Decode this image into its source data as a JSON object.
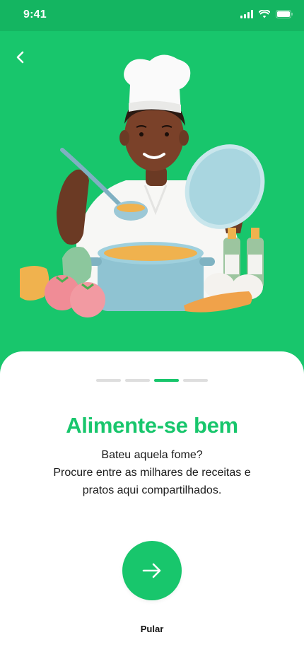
{
  "status_bar": {
    "time": "9:41"
  },
  "onboarding": {
    "step_count": 4,
    "active_step": 3,
    "title": "Alimente-se bem",
    "description_lines": [
      "Bateu aquela fome?",
      "Procure entre as milhares de receitas e",
      "pratos aqui compartilhados."
    ],
    "skip_label": "Pular"
  },
  "colors": {
    "accent": "#18c66c",
    "status_bar": "#14b561",
    "sheet": "#ffffff",
    "text": "#1a1a1a"
  },
  "icons": {
    "back": "chevron-left-icon",
    "next": "arrow-right-icon"
  }
}
